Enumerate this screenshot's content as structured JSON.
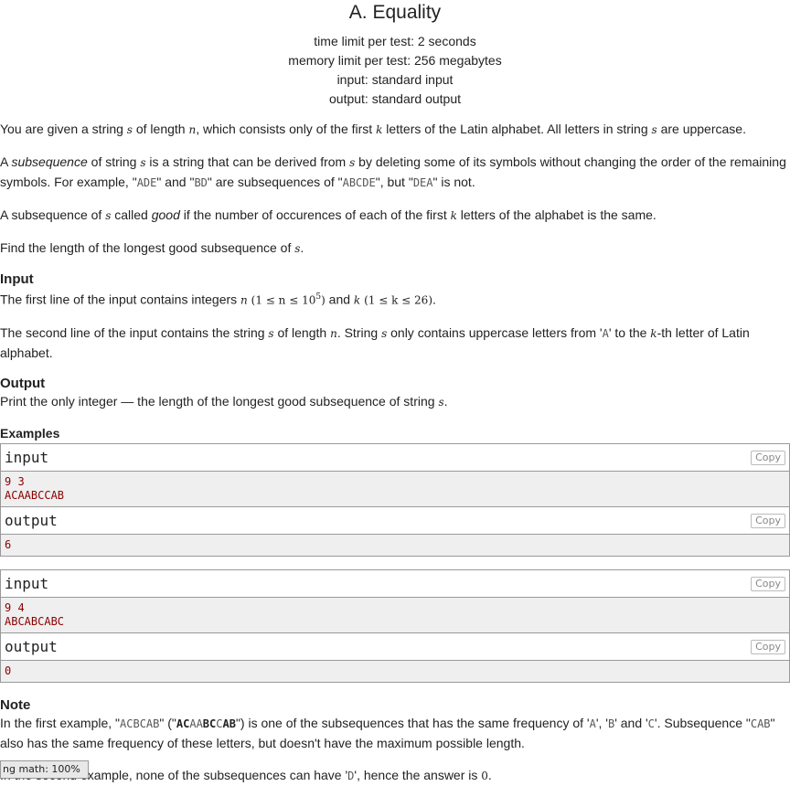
{
  "problem": {
    "title": "A. Equality",
    "time_limit": "time limit per test: 2 seconds",
    "memory_limit": "memory limit per test: 256 megabytes",
    "input_line": "input: standard input",
    "output_line": "output: standard output"
  },
  "statement": {
    "p1": {
      "a": "You are given a string ",
      "s": "s",
      "b": " of length ",
      "n": "n",
      "c": ", which consists only of the first ",
      "k": "k",
      "d": " letters of the Latin alphabet. All letters in string ",
      "s2": "s",
      "e": " are uppercase."
    },
    "p2": {
      "a": "A ",
      "sub": "subsequence",
      "b": " of string ",
      "s": "s",
      "c": " is a string that can be derived from ",
      "s2": "s",
      "d": " by deleting some of its symbols without changing the order of the remaining symbols. For example, \"",
      "ex1": "ADE",
      "e": "\" and \"",
      "ex2": "BD",
      "f": "\" are subsequences of \"",
      "ex3": "ABCDE",
      "g": "\", but \"",
      "ex4": "DEA",
      "h": "\" is not."
    },
    "p3": {
      "a": "A subsequence of ",
      "s": "s",
      "b": " called ",
      "good": "good",
      "c": " if the number of occurences of each of the first ",
      "k": "k",
      "d": " letters of the alphabet is the same."
    },
    "p4": {
      "a": "Find the length of the longest good subsequence of ",
      "s": "s",
      "b": "."
    }
  },
  "input_section": {
    "title": "Input",
    "p1": {
      "a": "The first line of the input contains integers ",
      "n": "n",
      "r1": "(1 ≤ n ≤ 10",
      "exp": "5",
      "r1b": ")",
      "b": " and ",
      "k": "k",
      "r2": "(1 ≤ k ≤ 26)",
      "c": "."
    },
    "p2": {
      "a": "The second line of the input contains the string ",
      "s": "s",
      "b": " of length ",
      "n": "n",
      "c": ". String ",
      "s2": "s",
      "d": " only contains uppercase letters from '",
      "A": "A",
      "e": "' to the ",
      "k": "k",
      "f": "-th letter of Latin alphabet."
    }
  },
  "output_section": {
    "title": "Output",
    "p1": {
      "a": "Print the only integer — the length of the longest good subsequence of string ",
      "s": "s",
      "b": "."
    }
  },
  "examples": {
    "title": "Examples",
    "copy_label": "Copy",
    "input_label": "input",
    "output_label": "output",
    "items": [
      {
        "input": [
          "9 3",
          "ACAABCCAB"
        ],
        "output": [
          "6"
        ]
      },
      {
        "input": [
          "9 4",
          "ABCABCABC"
        ],
        "output": [
          "0"
        ]
      }
    ]
  },
  "note": {
    "title": "Note",
    "p1": {
      "a": "In the first example, \"",
      "ex1": "ACBCAB",
      "b": "\" (\"",
      "seq": [
        {
          "t": "AC",
          "bold": true
        },
        {
          "t": "AA",
          "bold": false
        },
        {
          "t": "BC",
          "bold": true
        },
        {
          "t": "C",
          "bold": false
        },
        {
          "t": "AB",
          "bold": true
        }
      ],
      "c": "\") is one of the subsequences that has the same frequency of '",
      "A": "A",
      "d": "', '",
      "B": "B",
      "e": "' and '",
      "C": "C",
      "f": "'. Subsequence \"",
      "ex2": "CAB",
      "g": "\" also has the same frequency of these letters, but doesn't have the maximum possible length."
    },
    "p2": {
      "a": "In the second example, none of the subsequences can have '",
      "D": "D",
      "b": "', hence the answer is ",
      "zero": "0",
      "c": "."
    }
  },
  "math_status": "ng math: 100%"
}
